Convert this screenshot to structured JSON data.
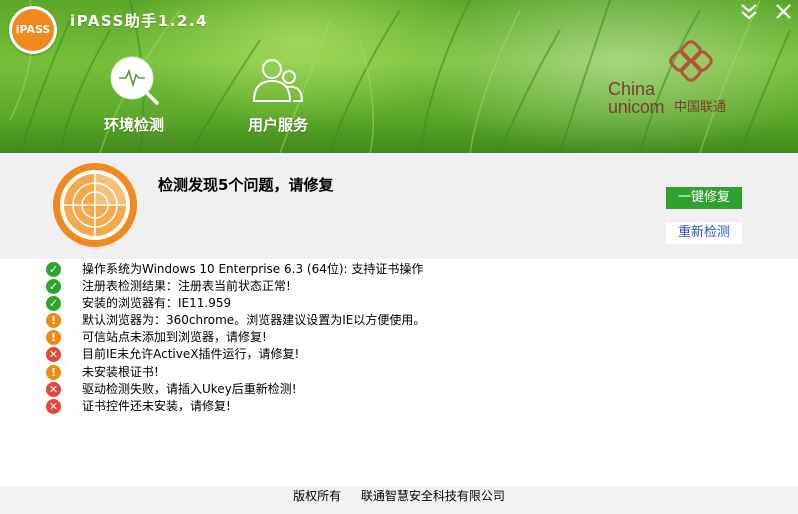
{
  "app": {
    "title": "iPASS助手1.2.4",
    "logo_text": "iPASS"
  },
  "nav": [
    {
      "label": "环境检测",
      "icon": "monitor-search-icon"
    },
    {
      "label": "用户服务",
      "icon": "users-icon"
    }
  ],
  "brand": {
    "china": "China",
    "unicom": "unicom",
    "cn": "中国联通"
  },
  "status": {
    "message": "检测发现5个问题，请修复",
    "fix_button": "一键修复",
    "recheck_button": "重新检测"
  },
  "results": [
    {
      "status": "ok",
      "text": "操作系统为Windows 10 Enterprise 6.3 (64位): 支持证书操作"
    },
    {
      "status": "ok",
      "text": "注册表检测结果：注册表当前状态正常!"
    },
    {
      "status": "ok",
      "text": "安装的浏览器有：IE11.959"
    },
    {
      "status": "warning",
      "text": "默认浏览器为：360chrome。浏览器建议设置为IE以方便使用。"
    },
    {
      "status": "warning",
      "text": "可信站点未添加到浏览器，请修复!"
    },
    {
      "status": "error",
      "text": "目前IE未允许ActiveX插件运行，请修复!"
    },
    {
      "status": "warning",
      "text": "未安装根证书!"
    },
    {
      "status": "error",
      "text": "驱动检测失败，请插入Ukey后重新检测!"
    },
    {
      "status": "error",
      "text": "证书控件还未安装，请修复!"
    }
  ],
  "footer": {
    "copyright": "版权所有",
    "company": "联通智慧安全科技有限公司"
  },
  "colors": {
    "ok": "#2ca32c",
    "warning": "#ef8a14",
    "error": "#e0483c",
    "accent_orange": "#f08a1e",
    "fix_button": "#2da32d",
    "link_blue": "#2b56c9"
  }
}
